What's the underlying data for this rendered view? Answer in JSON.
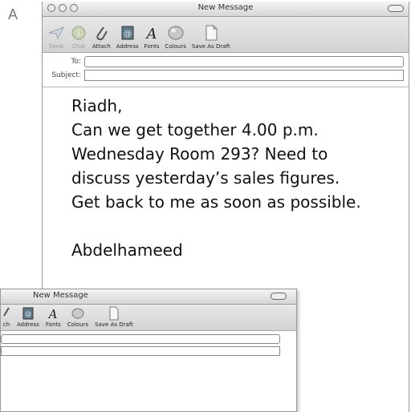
{
  "figure_label": "A",
  "window": {
    "title": "New Message",
    "toolbar": [
      {
        "label": "Send",
        "icon": "send-icon",
        "enabled": false
      },
      {
        "label": "Chat",
        "icon": "chat-icon",
        "enabled": false
      },
      {
        "label": "Attach",
        "icon": "paperclip-icon",
        "enabled": true
      },
      {
        "label": "Address",
        "icon": "address-book-icon",
        "enabled": true
      },
      {
        "label": "Fonts",
        "icon": "fonts-icon",
        "enabled": true
      },
      {
        "label": "Colours",
        "icon": "colours-icon",
        "enabled": true
      },
      {
        "label": "Save As Draft",
        "icon": "draft-icon",
        "enabled": true
      }
    ],
    "to_label": "To:",
    "to_value": "",
    "subject_label": "Subject:",
    "subject_value": "",
    "body": {
      "greeting": "Riadh,",
      "lines": [
        "Can we get together 4.00 p.m.",
        "Wednesday Room 293? Need to",
        "discuss  yesterday’s  sales  figures.",
        "Get back to me as soon as possible."
      ],
      "signature": "Abdelhameed"
    }
  },
  "back_window": {
    "title": "New Message",
    "toolbar": [
      {
        "label": "ch",
        "icon": "attach-partial-icon"
      },
      {
        "label": "Address",
        "icon": "address-book-icon"
      },
      {
        "label": "Fonts",
        "icon": "fonts-icon"
      },
      {
        "label": "Colours",
        "icon": "colours-icon"
      },
      {
        "label": "Save As Draft",
        "icon": "draft-icon"
      }
    ]
  }
}
